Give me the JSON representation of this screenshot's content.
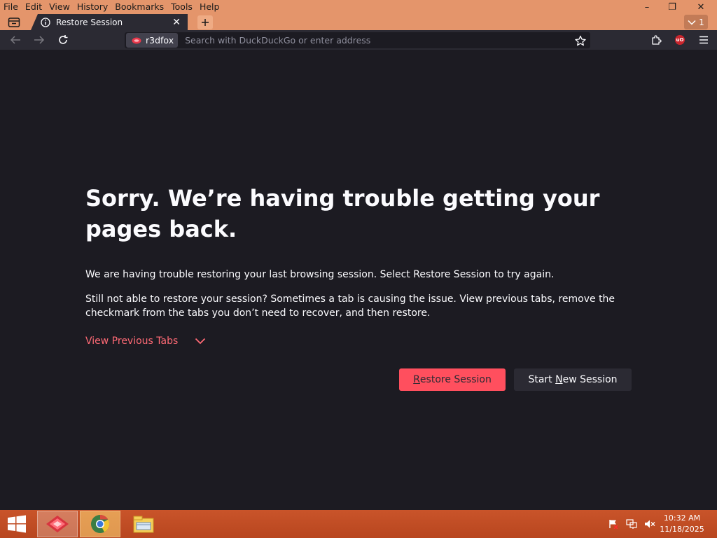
{
  "menu": {
    "file": "File",
    "edit": "Edit",
    "view": "View",
    "history": "History",
    "bookmarks": "Bookmarks",
    "tools": "Tools",
    "help": "Help"
  },
  "window_controls": {
    "minimize": "–",
    "restore": "❐",
    "close": "✕"
  },
  "tab": {
    "title": "Restore Session",
    "close": "✕"
  },
  "tabs_count": "1",
  "urlbar": {
    "identity_label": "r3dfox",
    "placeholder": "Search with DuckDuckGo or enter address"
  },
  "page": {
    "heading": "Sorry. We’re having trouble getting your pages back.",
    "para1": "We are having trouble restoring your last browsing session. Select Restore Session to try again.",
    "para2": "Still not able to restore your session? Sometimes a tab is causing the issue. View previous tabs, remove the checkmark from the tabs you don’t need to recover, and then restore.",
    "view_previous_tabs": "View Previous Tabs",
    "restore_session_first": "R",
    "restore_session_rest": "estore Session",
    "new_session_a": "Start ",
    "new_session_u": "N",
    "new_session_b": "ew Session"
  },
  "taskbar": {
    "time": "10:32 AM",
    "date": "11/18/2025"
  },
  "colors": {
    "titlebar": "#e4956b",
    "toolbar": "#2b2a33",
    "page_bg": "#1c1b22",
    "accent": "#ff4f5e",
    "link": "#ff6a75",
    "taskbar": "#c9542a"
  },
  "icons": [
    "tab-list-icon",
    "info-icon",
    "plus-icon",
    "chevron-down-icon",
    "back-arrow-icon",
    "forward-arrow-icon",
    "reload-icon",
    "r3dfox-logo-icon",
    "bookmark-star-icon",
    "extensions-icon",
    "ublock-icon",
    "hamburger-menu-icon",
    "windows-start-icon",
    "r3dfox-taskbar-icon",
    "chrome-taskbar-icon",
    "file-explorer-icon",
    "action-center-flag-icon",
    "network-icon",
    "volume-muted-icon"
  ]
}
